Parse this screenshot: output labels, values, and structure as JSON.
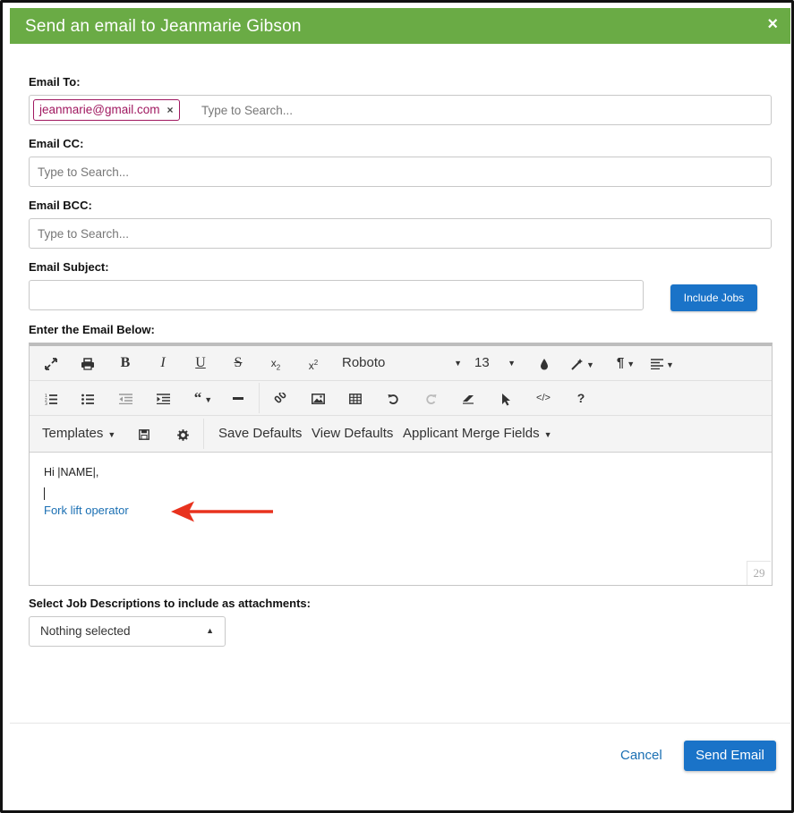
{
  "dialog": {
    "title": "Send an email to Jeanmarie Gibson",
    "close_glyph": "×"
  },
  "email_to": {
    "label": "Email To:",
    "chips": [
      "jeanmarie@gmail.com"
    ],
    "chip_remove_glyph": "×",
    "placeholder": "Type to Search..."
  },
  "email_cc": {
    "label": "Email CC:",
    "placeholder": "Type to Search..."
  },
  "email_bcc": {
    "label": "Email BCC:",
    "placeholder": "Type to Search..."
  },
  "email_subject": {
    "label": "Email Subject:",
    "value": "",
    "include_jobs_label": "Include Jobs"
  },
  "editor": {
    "label": "Enter the Email Below:",
    "font_name": "Roboto",
    "font_size": "13",
    "templates_label": "Templates",
    "save_defaults_label": "Save Defaults",
    "view_defaults_label": "View Defaults",
    "merge_fields_label": "Applicant Merge Fields",
    "body_line1": "Hi |NAME|,",
    "body_link": "Fork lift operator",
    "char_count": "29"
  },
  "attachments": {
    "label": "Select Job Descriptions to include as attachments:",
    "selected": "Nothing selected"
  },
  "footer": {
    "cancel_label": "Cancel",
    "send_label": "Send Email"
  },
  "colors": {
    "header_green": "#6aab45",
    "primary_blue": "#1a73c8",
    "chip_magenta": "#a01860",
    "arrow_red": "#e8321e"
  }
}
